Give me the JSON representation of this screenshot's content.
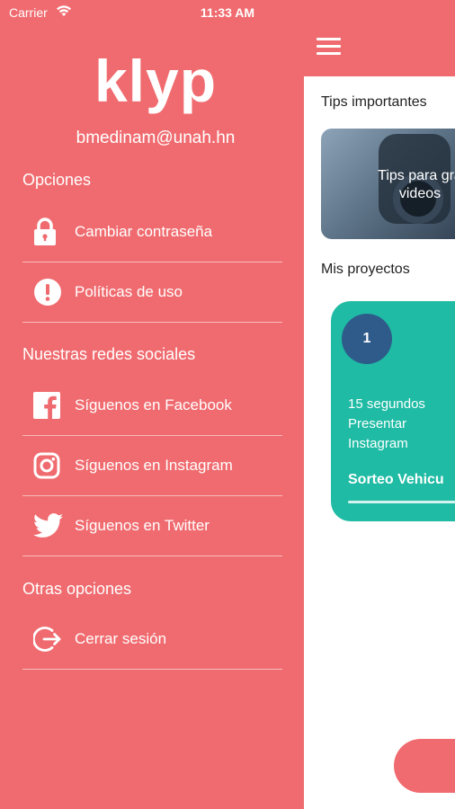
{
  "status_bar": {
    "carrier": "Carrier",
    "time": "11:33 AM"
  },
  "drawer": {
    "logo": "klyp",
    "email": "bmedinam@unah.hn",
    "sections": {
      "options": "Opciones",
      "social": "Nuestras redes sociales",
      "other": "Otras opciones"
    },
    "items": {
      "change_password": "Cambiar contraseña",
      "policies": "Políticas de uso",
      "facebook": "Síguenos en Facebook",
      "instagram": "Síguenos en Instagram",
      "twitter": "Síguenos en Twitter",
      "logout": "Cerrar sesión"
    },
    "icons": [
      "lock-icon",
      "alert-icon",
      "facebook-icon",
      "instagram-icon",
      "twitter-icon",
      "logout-icon"
    ]
  },
  "main": {
    "tips_title": "Tips importantes",
    "tip_card": {
      "line1": "Tips para gra",
      "line2": "videos"
    },
    "projects_title": "Mis proyectos",
    "project": {
      "number": "1",
      "duration": "15 segundos",
      "type": "Presentar",
      "platform": "Instagram",
      "name": "Sorteo Vehicu"
    }
  },
  "colors": {
    "accent": "#f06b6f",
    "project_card": "#1fbba4",
    "number_badge": "#2e5b8a"
  }
}
